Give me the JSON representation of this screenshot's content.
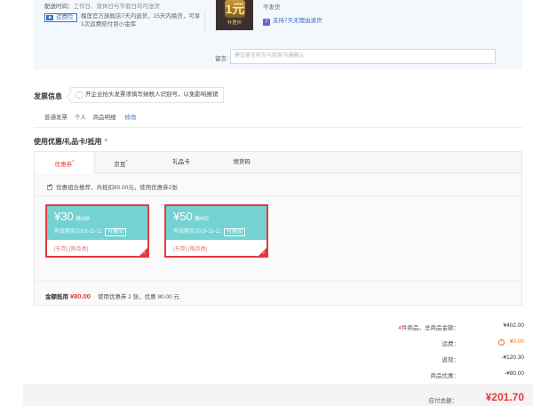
{
  "shipping": {
    "delivery_label": "配送时间：",
    "delivery_time": "工作日、双休日与节假日均可送货",
    "insurance_badge": "运费险",
    "insurance_text": "榴莲官方旗舰店7天内退货，15天内换货，可享1次运费赔付到小金库",
    "no_ship": "不发货",
    "return_tip": "支持7天无理由退货",
    "product_image_text": "1元",
    "product_image_sub": "补差价",
    "memo_label": "留言:",
    "memo_placeholder": "建议留言前先与商家沟通确认"
  },
  "invoice": {
    "title": "发票信息",
    "tip": "开企业抬头发票须填写纳税人识别号，以免影响报销",
    "type": "普通发票",
    "holder": "个人",
    "content": "商品明细",
    "edit": "修改"
  },
  "coupons": {
    "title": "使用优惠/礼品卡/抵用",
    "chevron": "^",
    "tabs": [
      {
        "label": "优惠券",
        "marked": true
      },
      {
        "label": "京豆",
        "marked": true
      },
      {
        "label": "礼品卡",
        "marked": false
      },
      {
        "label": "领货码",
        "marked": false
      }
    ],
    "tab_mark": "*",
    "combo_text": "优惠组合推荐，共抵扣80.00元，使用优惠券2张",
    "items": [
      {
        "amount": "¥30",
        "condition": "满199",
        "valid": "有效期至2019-11-11",
        "stack": "可叠加",
        "scope": "[东券] [限品类]"
      },
      {
        "amount": "¥50",
        "condition": "满400",
        "valid": "有效期至2019-11-11",
        "stack": "可叠加",
        "scope": "[东券] [限品类]"
      }
    ],
    "summary_label": "金额抵用",
    "summary_amount": "¥80.00",
    "summary_detail": "使用优惠券 2 张，优惠 80.00 元"
  },
  "totals": {
    "count": "4",
    "count_suffix": "件商品，总商品金额：",
    "goods_amount": "¥402.00",
    "freight_label": "运费：",
    "freight_value": "¥0.00",
    "rebate_label": "返现：",
    "rebate_value": "-¥120.30",
    "discount_label": "商品优惠：",
    "discount_value": "-¥80.00",
    "payable_label": "应付总额：",
    "payable_value": "¥201.70"
  },
  "colors": {
    "accent_red": "#e4393c",
    "coupon_teal": "#74d2d2",
    "link_blue": "#3a6fc4",
    "orange": "#ff6c00"
  }
}
